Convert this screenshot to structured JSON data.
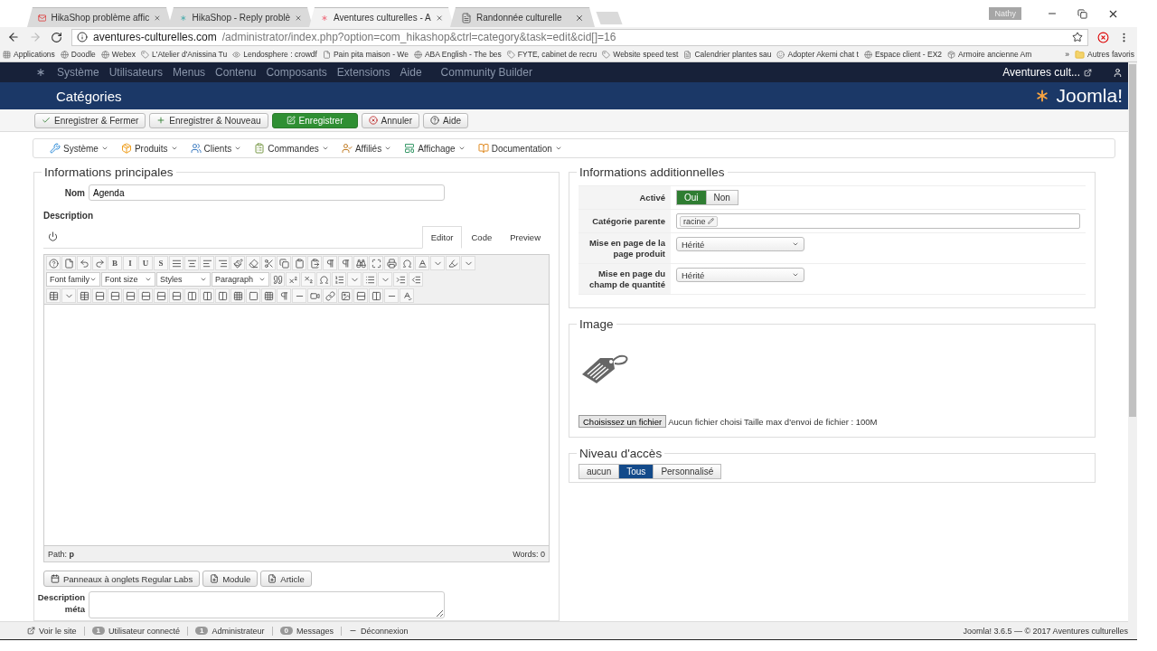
{
  "browser": {
    "tabs": [
      {
        "title": "HikaShop problème affic",
        "selected": false
      },
      {
        "title": "HikaShop - Reply problè",
        "selected": false
      },
      {
        "title": "Aventures culturelles - A",
        "selected": true
      },
      {
        "title": "Randonnée culturelle",
        "selected": false
      }
    ],
    "profile": "Nathy",
    "url_host": "aventures-culturelles.com",
    "url_path": "/administrator/index.php?option=com_hikashop&ctrl=category&task=edit&cid[]=16",
    "bookmarks": [
      "Applications",
      "Doodle",
      "Webex",
      "L'Atelier d'Anissina Tu",
      "Lendosphere : crowdf",
      "Pain pita maison - We",
      "ABA English - The bes",
      "FYTE, cabinet de recru",
      "Website speed test",
      "Calendrier plantes sau",
      "Adopter Akemi chat t",
      "Espace client - EX2",
      "Armoire ancienne Am"
    ],
    "more": "»",
    "other_bookmarks": "Autres favoris"
  },
  "admin_menu": {
    "items": [
      "Système",
      "Utilisateurs",
      "Menus",
      "Contenu",
      "Composants",
      "Extensions",
      "Aide",
      "Community Builder"
    ],
    "site": "Aventures cult..."
  },
  "header": {
    "title": "Catégories",
    "logo": "Joomla!"
  },
  "toolbar": [
    {
      "label": "Enregistrer & Fermer",
      "kind": "default"
    },
    {
      "label": "Enregistrer & Nouveau",
      "kind": "default"
    },
    {
      "label": "Enregistrer",
      "kind": "success"
    },
    {
      "label": "Annuler",
      "kind": "default"
    },
    {
      "label": "Aide",
      "kind": "default"
    }
  ],
  "hikashop_menu": [
    "Système",
    "Produits",
    "Clients",
    "Commandes",
    "Affiliés",
    "Affichage",
    "Documentation"
  ],
  "main": {
    "legend": "Informations principales",
    "name_label": "Nom",
    "name_value": "Agenda",
    "description_label": "Description",
    "editor": {
      "tabs": [
        {
          "label": "Editor",
          "selected": true
        },
        {
          "label": "Code",
          "selected": false
        },
        {
          "label": "Preview",
          "selected": false
        }
      ],
      "format_buttons": [
        "B",
        "I",
        "U",
        "S"
      ],
      "selects": [
        "Font family",
        "Font size",
        "Styles",
        "Paragraph"
      ],
      "path_label": "Path:",
      "path_value": "p",
      "words_label": "Words:",
      "words_value": "0"
    },
    "buttons": [
      "Panneaux à onglets Regular Labs",
      "Module",
      "Article"
    ],
    "meta_label": "Description méta"
  },
  "additional": {
    "legend": "Informations additionnelles",
    "active_label": "Activé",
    "active_options": [
      {
        "label": "Oui",
        "selected": true
      },
      {
        "label": "Non",
        "selected": false
      }
    ],
    "parent_label": "Catégorie parente",
    "parent_tag": "racine",
    "selects": [
      {
        "label": "Mise en page de la page produit",
        "value": "Hérité"
      },
      {
        "label": "Mise en page du champ de quantité",
        "value": "Hérité"
      }
    ]
  },
  "image": {
    "legend": "Image",
    "file_button": "Choisissez un fichier",
    "file_status": "Aucun fichier choisi",
    "max_size": "Taille max d'envoi de fichier : 100M"
  },
  "access": {
    "legend": "Niveau d'accès",
    "options": [
      {
        "label": "aucun",
        "selected": false
      },
      {
        "label": "Tous",
        "selected": true
      },
      {
        "label": "Personnalisé",
        "selected": false
      }
    ]
  },
  "status_bar": {
    "view_site": "Voir le site",
    "counters": [
      {
        "count": "1",
        "label": "Utilisateur connecté"
      },
      {
        "count": "1",
        "label": "Administrateur"
      },
      {
        "count": "0",
        "label": "Messages"
      }
    ],
    "logout": "Déconnexion",
    "version": "Joomla! 3.6.5 — © 2017 Aventures culturelles"
  }
}
